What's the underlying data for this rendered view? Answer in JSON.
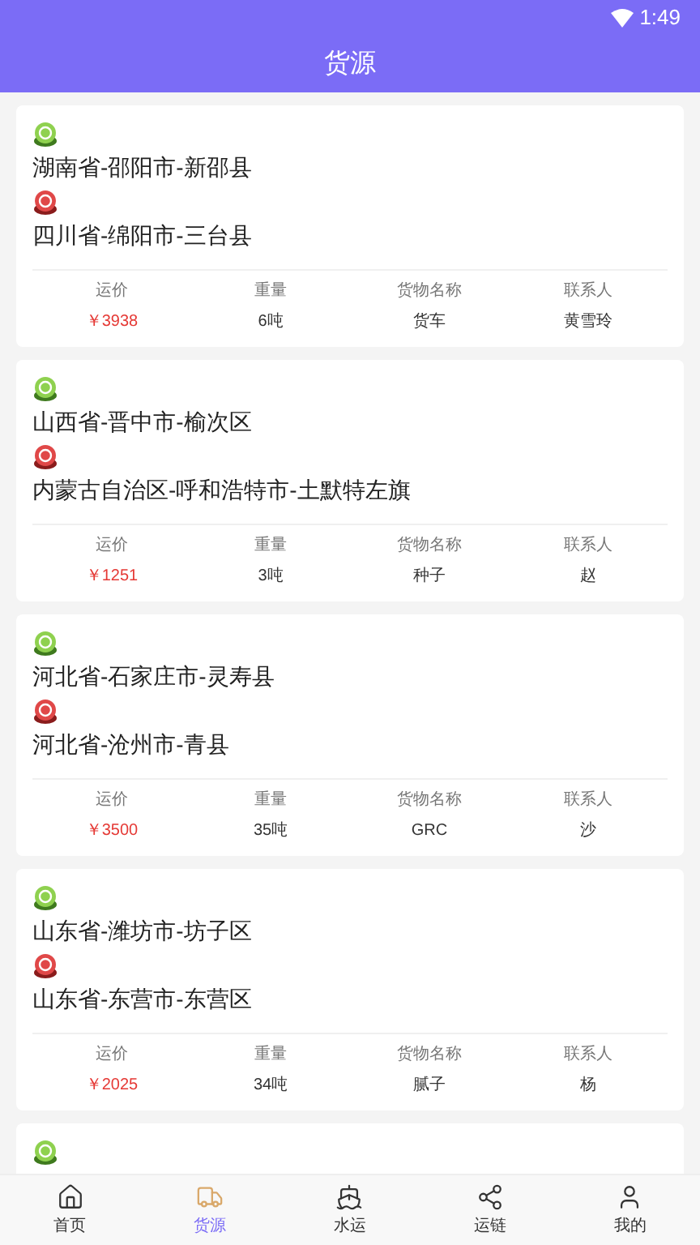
{
  "status_bar": {
    "time": "1:49"
  },
  "header": {
    "title": "货源"
  },
  "cards": [
    {
      "origin": "湖南省-邵阳市-新邵县",
      "destination": "四川省-绵阳市-三台县",
      "fields": [
        {
          "label": "运价",
          "value": "￥3938",
          "kind": "price"
        },
        {
          "label": "重量",
          "value": "6吨",
          "kind": "plain"
        },
        {
          "label": "货物名称",
          "value": "货车",
          "kind": "plain"
        },
        {
          "label": "联系人",
          "value": "黄雪玲",
          "kind": "plain"
        }
      ]
    },
    {
      "origin": "山西省-晋中市-榆次区",
      "destination": "内蒙古自治区-呼和浩特市-土默特左旗",
      "fields": [
        {
          "label": "运价",
          "value": "￥1251",
          "kind": "price"
        },
        {
          "label": "重量",
          "value": "3吨",
          "kind": "plain"
        },
        {
          "label": "货物名称",
          "value": "种子",
          "kind": "plain"
        },
        {
          "label": "联系人",
          "value": "赵",
          "kind": "plain"
        }
      ]
    },
    {
      "origin": "河北省-石家庄市-灵寿县",
      "destination": "河北省-沧州市-青县",
      "fields": [
        {
          "label": "运价",
          "value": "￥3500",
          "kind": "price"
        },
        {
          "label": "重量",
          "value": "35吨",
          "kind": "plain"
        },
        {
          "label": "货物名称",
          "value": "GRC",
          "kind": "plain"
        },
        {
          "label": "联系人",
          "value": "沙",
          "kind": "plain"
        }
      ]
    },
    {
      "origin": "山东省-潍坊市-坊子区",
      "destination": "山东省-东营市-东营区",
      "fields": [
        {
          "label": "运价",
          "value": "￥2025",
          "kind": "price"
        },
        {
          "label": "重量",
          "value": "34吨",
          "kind": "plain"
        },
        {
          "label": "货物名称",
          "value": "腻子",
          "kind": "plain"
        },
        {
          "label": "联系人",
          "value": "杨",
          "kind": "plain"
        }
      ]
    }
  ],
  "next_card_peek": true,
  "nav": [
    {
      "label": "首页",
      "kind": "home",
      "selected": false
    },
    {
      "label": "货源",
      "kind": "truck",
      "selected": true
    },
    {
      "label": "水运",
      "kind": "ship",
      "selected": false
    },
    {
      "label": "运链",
      "kind": "share",
      "selected": false
    },
    {
      "label": "我的",
      "kind": "user",
      "selected": false
    }
  ]
}
